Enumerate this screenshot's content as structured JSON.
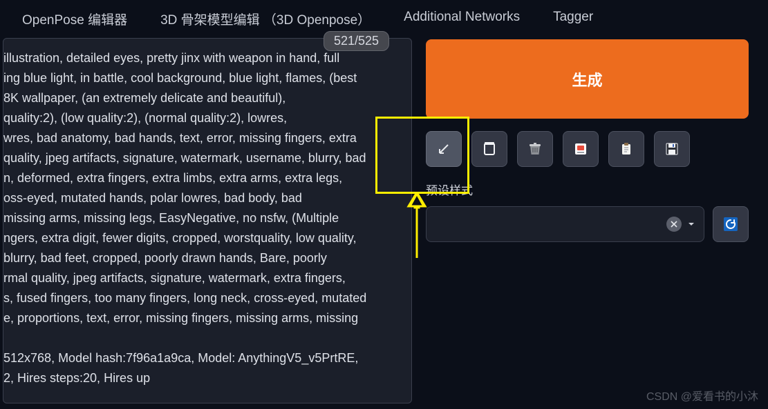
{
  "tabs": {
    "openpose": "OpenPose 编辑器",
    "skeleton3d": "3D 骨架模型编辑 （3D Openpose）",
    "additional": "Additional Networks",
    "tagger": "Tagger"
  },
  "counter": "521/525",
  "prompt_text": " illustration, detailed eyes, pretty jinx with weapon in hand, full\ning blue light, in battle, cool background, blue light, flames, (best\n 8K wallpaper, (an extremely delicate and beautiful),\nquality:2), (low quality:2), (normal quality:2), lowres,\nwres, bad anatomy, bad hands, text, error, missing fingers, extra\nquality, jpeg artifacts, signature, watermark, username, blurry, bad\nn, deformed, extra fingers, extra limbs, extra arms, extra legs,\noss-eyed, mutated hands, polar lowres, bad body, bad\n missing arms, missing legs, EasyNegative, no nsfw, (Multiple\nngers, extra digit, fewer digits, cropped, worstquality, low quality,\n blurry, bad feet, cropped, poorly drawn hands, Bare, poorly\nrmal quality, jpeg artifacts, signature, watermark, extra fingers,\ns, fused fingers, too many fingers, long neck, cross-eyed, mutated\ne, proportions, text, error, missing fingers, missing arms, missing\n\n512x768, Model hash:7f96a1a9ca, Model: AnythingV5_v5PrtRE,\n2, Hires steps:20, Hires up",
  "right": {
    "generate_label": "生成",
    "preset_label": "预设样式"
  },
  "icons": {
    "arrow_expand": "arrow-expand-icon",
    "new_doc": "new-doc-icon",
    "trash": "trash-icon",
    "art": "art-icon",
    "clipboard": "clipboard-icon",
    "save": "save-icon",
    "close": "close-icon",
    "chevron_down": "chevron-down-icon",
    "refresh": "refresh-icon"
  },
  "watermark": "CSDN @爱看书的小沐"
}
